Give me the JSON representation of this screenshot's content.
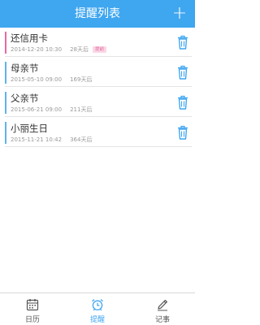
{
  "header": {
    "title": "提醒列表",
    "add_label": "+"
  },
  "reminders": [
    {
      "name": "还信用卡",
      "date": "2014-12-20 10:30",
      "days": "28天后",
      "badge": "提前",
      "color": "#e86aa0"
    },
    {
      "name": "母亲节",
      "date": "2015-05-10 09:00",
      "days": "169天后",
      "badge": "",
      "color": "#5fb3e8"
    },
    {
      "name": "父亲节",
      "date": "2015-06-21 09:00",
      "days": "211天后",
      "badge": "",
      "color": "#5fb3e8"
    },
    {
      "name": "小丽生日",
      "date": "2015-11-21 10:42",
      "days": "364天后",
      "badge": "",
      "color": "#5fb3e8"
    }
  ],
  "tabs": [
    {
      "label": "日历",
      "icon": "calendar-icon",
      "active": false
    },
    {
      "label": "提醒",
      "icon": "alarm-clock-icon",
      "active": true
    },
    {
      "label": "记事",
      "icon": "pencil-icon",
      "active": false
    }
  ],
  "colors": {
    "accent": "#3fa6f0",
    "header_bg": "#3fa6f0"
  }
}
